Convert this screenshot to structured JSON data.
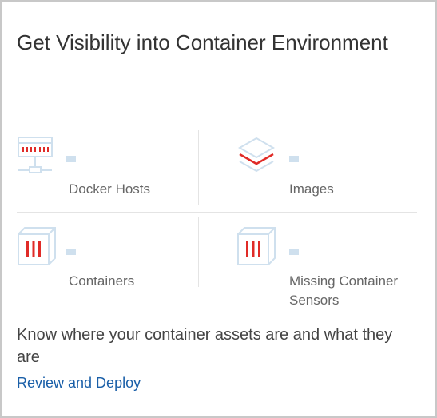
{
  "card": {
    "title": "Get Visibility into Container Environment",
    "stats": [
      {
        "icon": "docker-host-icon",
        "value": "--",
        "label": "Docker Hosts"
      },
      {
        "icon": "images-layers-icon",
        "value": "--",
        "label": "Images"
      },
      {
        "icon": "container-box-icon",
        "value": "--",
        "label": "Containers"
      },
      {
        "icon": "container-box-icon",
        "value": "--",
        "label": "Missing Container Sensors"
      }
    ],
    "description": "Know where your container assets are and what they are",
    "link_label": "Review and Deploy"
  },
  "colors": {
    "accent_red": "#e02b27",
    "icon_outline": "#cfe0ee",
    "link_blue": "#1a5fa8",
    "divider": "#e4e4e4"
  }
}
